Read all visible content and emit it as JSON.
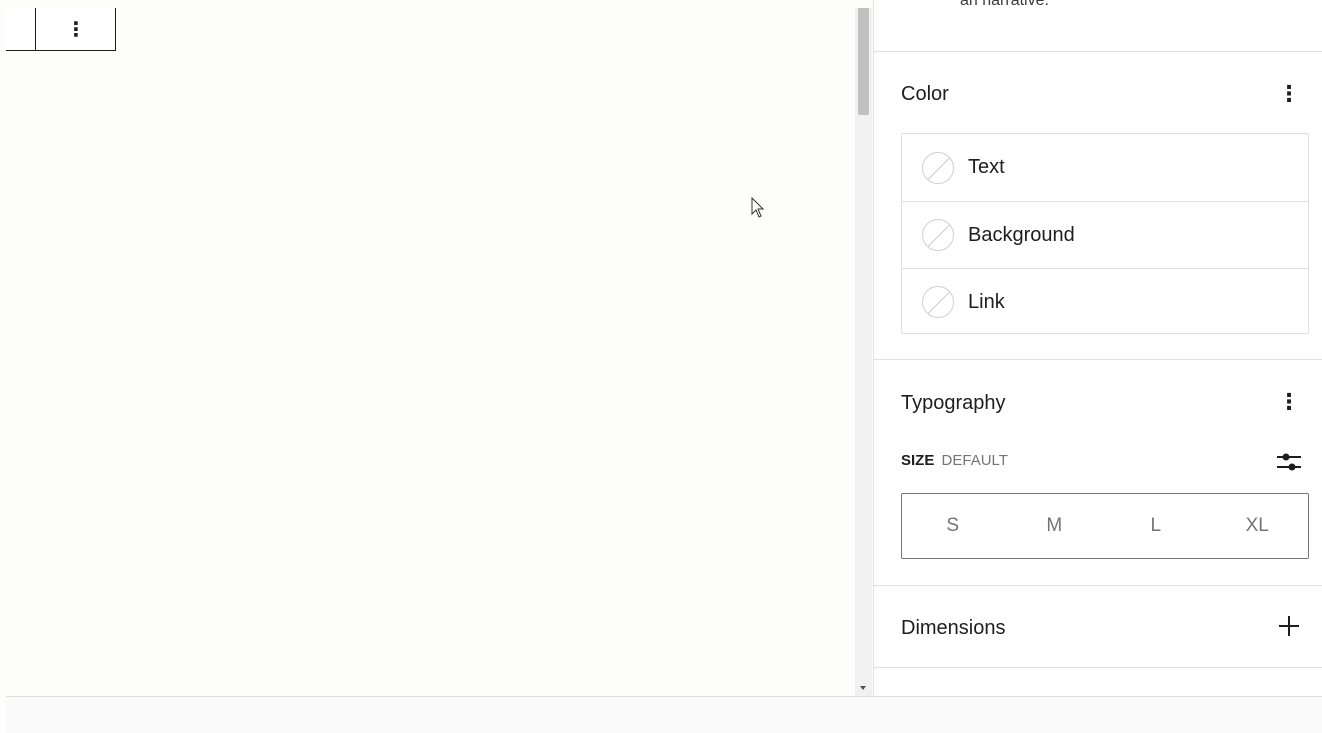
{
  "toolbar": {
    "more_glyph": "⋮"
  },
  "sidebar": {
    "narrative_fragment": "an narrative.",
    "color": {
      "title": "Color",
      "menu_glyph": "⋮",
      "items": [
        {
          "label": "Text"
        },
        {
          "label": "Background"
        },
        {
          "label": "Link"
        }
      ]
    },
    "typography": {
      "title": "Typography",
      "menu_glyph": "⋮",
      "size_key": "SIZE",
      "size_value": "DEFAULT",
      "sizes": [
        "S",
        "M",
        "L",
        "XL"
      ]
    },
    "dimensions": {
      "title": "Dimensions"
    }
  },
  "icons": {
    "swatch": "no-color-swatch-icon",
    "custom_size": "sliders-icon",
    "add": "plus-icon",
    "more": "more-vertical-icon"
  }
}
